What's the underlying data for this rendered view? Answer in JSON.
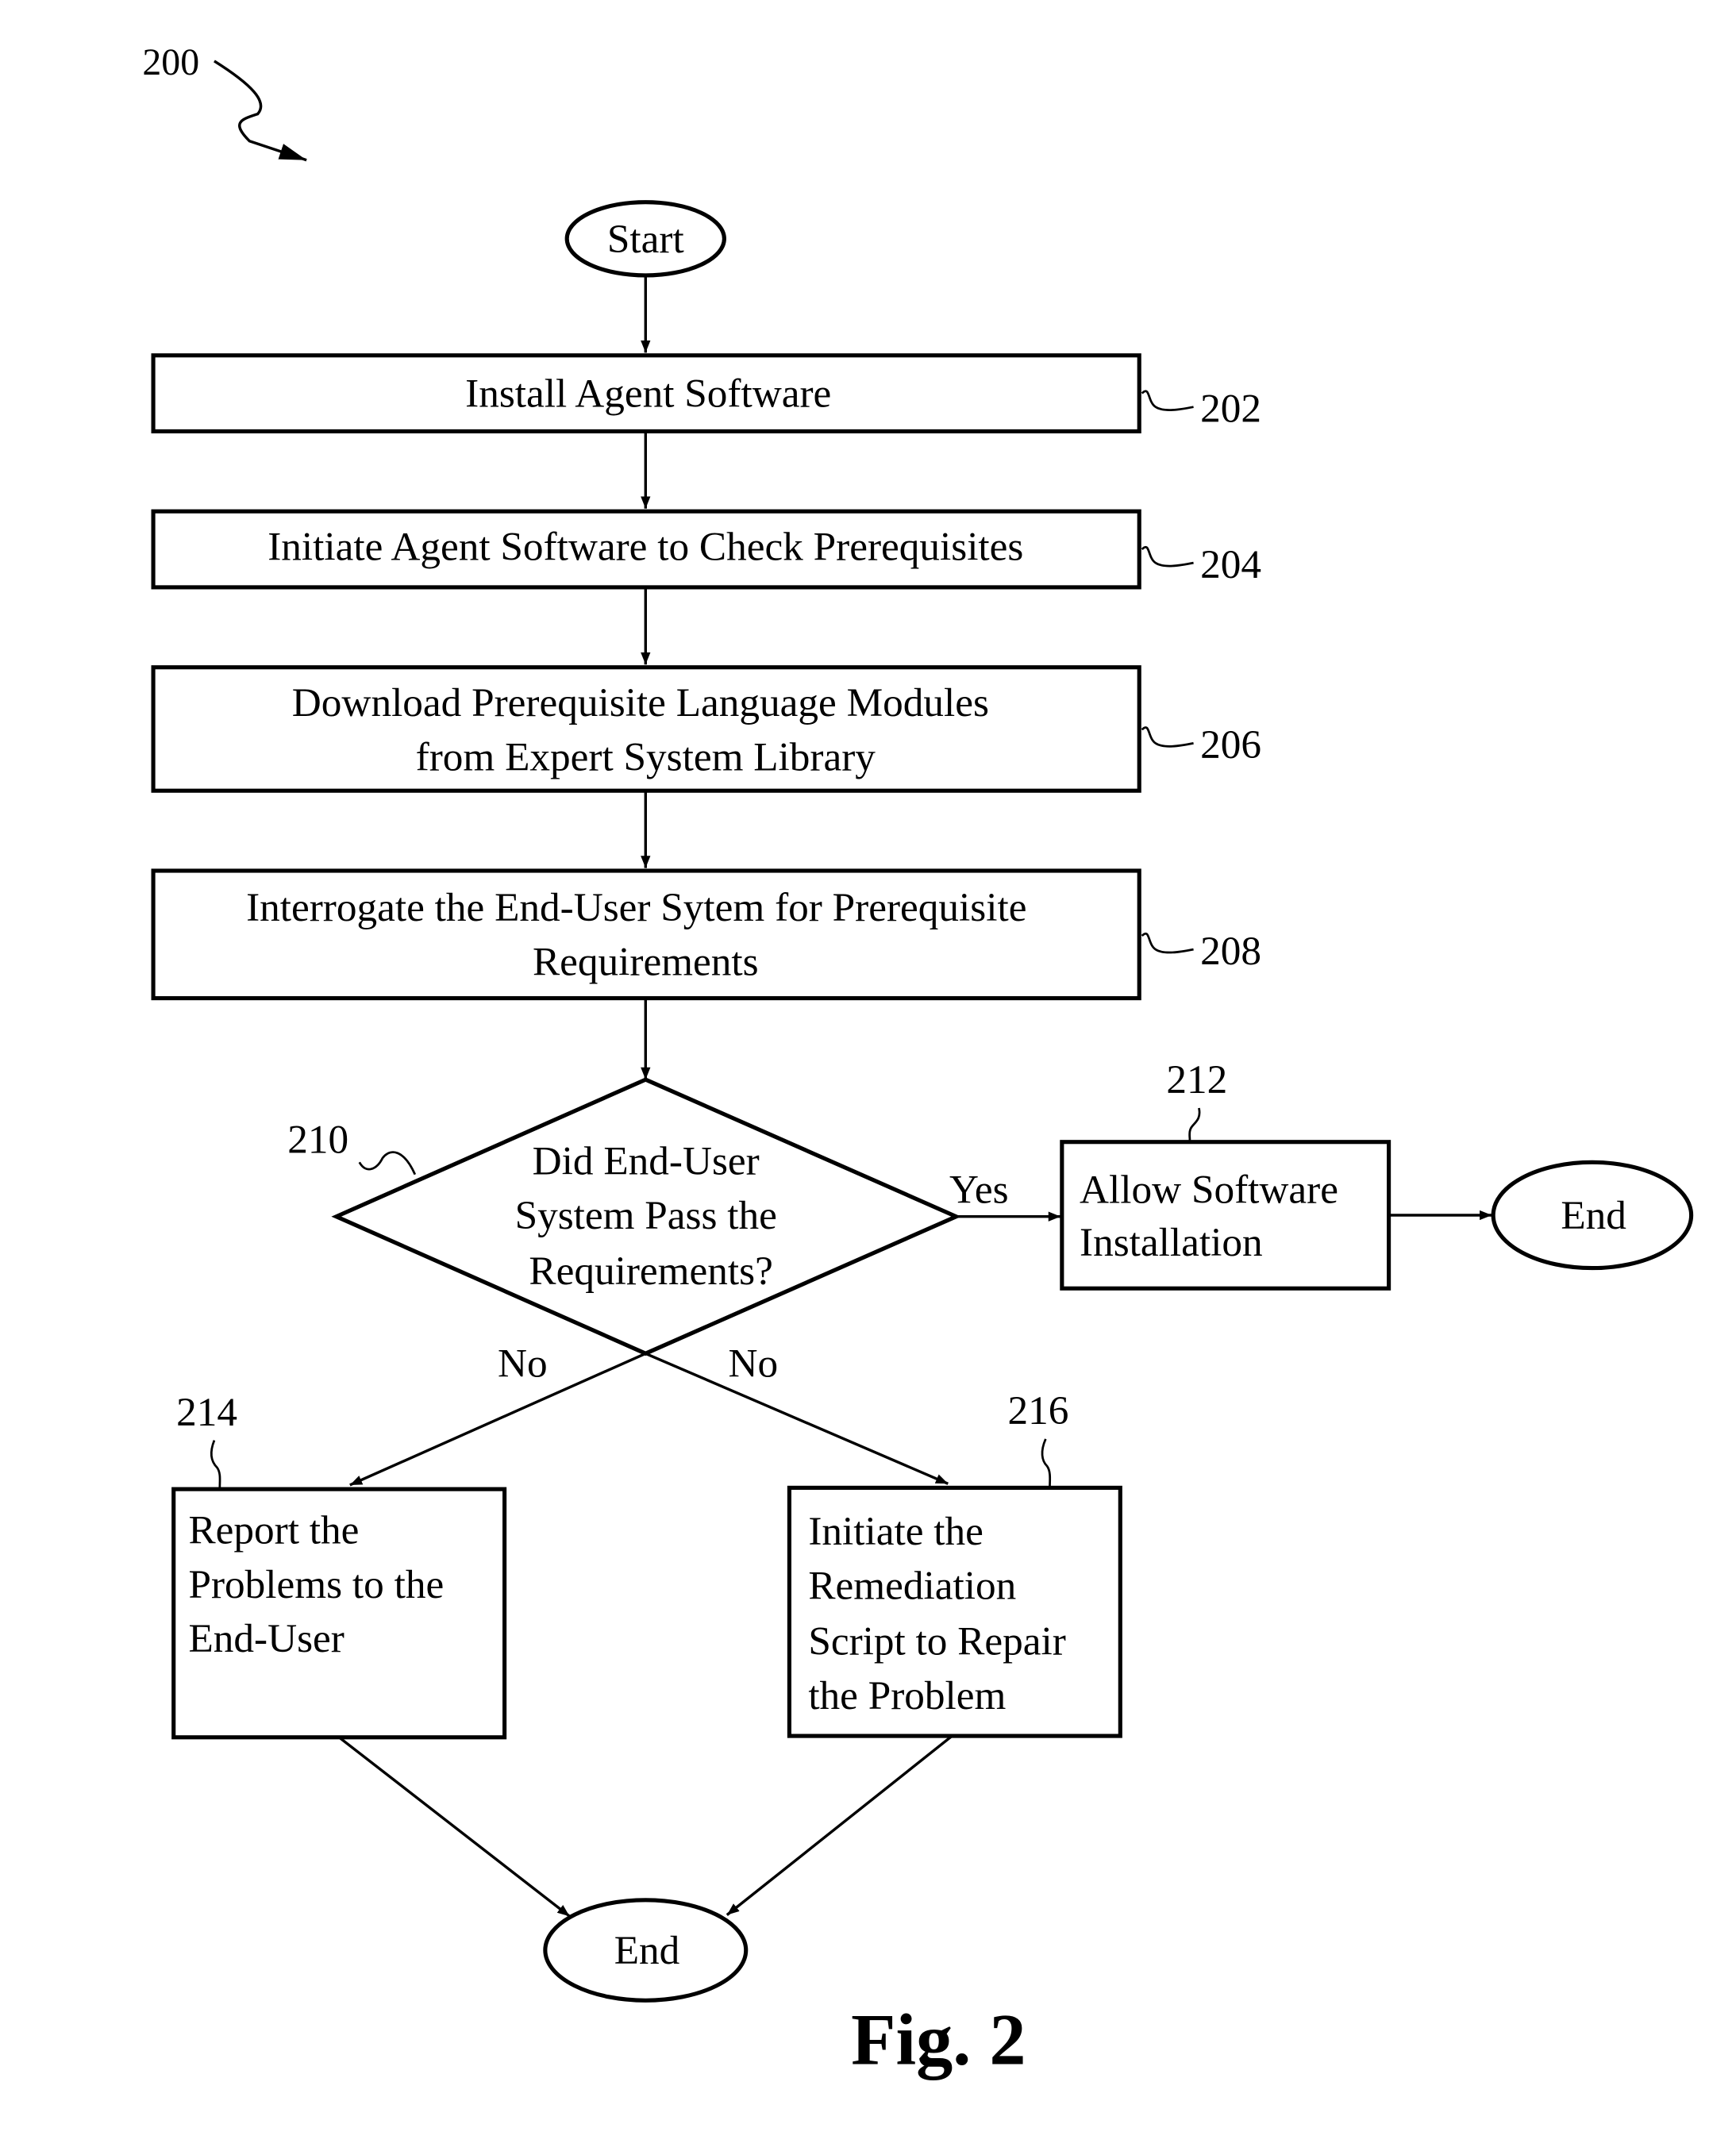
{
  "figure": {
    "ref_number": "200",
    "caption": "Fig. 2"
  },
  "nodes": {
    "start": {
      "label": "Start"
    },
    "install": {
      "ref": "202",
      "lines": [
        "Install Agent Software"
      ]
    },
    "initiate": {
      "ref": "204",
      "lines": [
        "Initiate Agent Software to Check Prerequisites"
      ]
    },
    "download": {
      "ref": "206",
      "lines": [
        "Download Prerequisite Language Modules",
        "from Expert System Library"
      ]
    },
    "interrogate": {
      "ref": "208",
      "lines": [
        "Interrogate the End-User Sytem for Prerequisite",
        "Requirements"
      ]
    },
    "decision": {
      "ref": "210",
      "lines": [
        "Did End-User",
        "System Pass the",
        "Requirements?"
      ]
    },
    "allow": {
      "ref": "212",
      "lines": [
        "Allow Software",
        "Installation"
      ]
    },
    "end_right": {
      "label": "End"
    },
    "report": {
      "ref": "214",
      "lines": [
        "Report the",
        "Problems to the",
        "End-User"
      ]
    },
    "remediate": {
      "ref": "216",
      "lines": [
        "Initiate the",
        "Remediation",
        "Script to Repair",
        "the Problem"
      ]
    },
    "end_bottom": {
      "label": "End"
    }
  },
  "edges": {
    "yes_label": "Yes",
    "no_left_label": "No",
    "no_right_label": "No"
  }
}
